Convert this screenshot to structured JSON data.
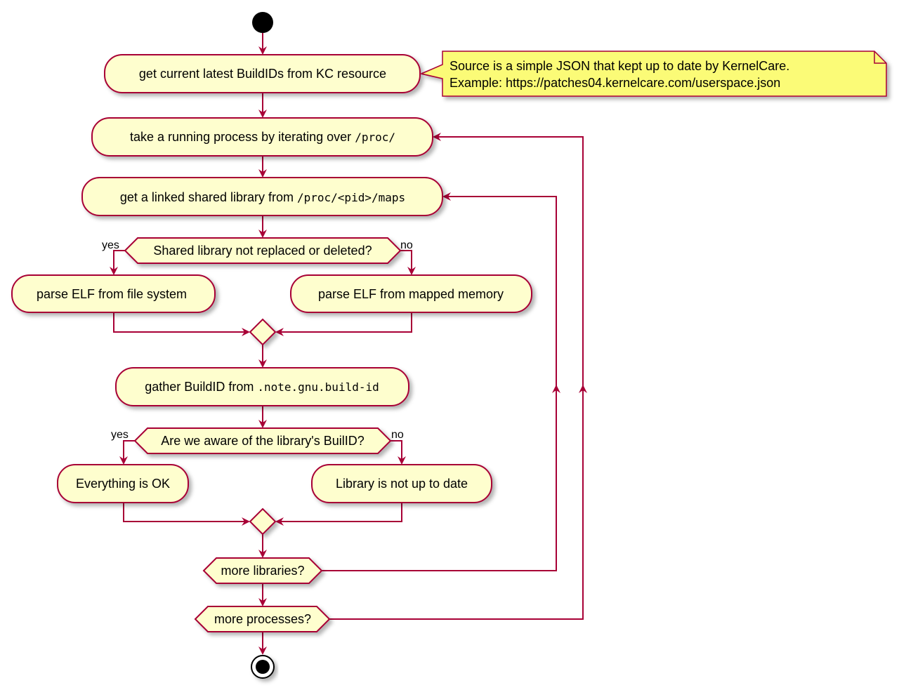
{
  "colors": {
    "fill": "#FEFECE",
    "stroke": "#A80036",
    "note_fill": "#FBFB77"
  },
  "nodes": {
    "get_buildids": "get current latest BuildIDs from KC resource",
    "take_process": {
      "text": "take a running process by iterating over ",
      "code": "/proc/"
    },
    "get_library": {
      "text": "get a linked shared library from ",
      "code": "/proc/<pid>/maps"
    },
    "decision_replaced": "Shared library not replaced or deleted?",
    "parse_fs": "parse ELF from file system",
    "parse_mem": "parse ELF from mapped memory",
    "gather_buildid": {
      "text": "gather BuildID from ",
      "code": ".note.gnu.build-id"
    },
    "decision_aware": "Are we aware of the library's BuilID?",
    "ok": "Everything is OK",
    "not_up_to_date": "Library is not up to date",
    "more_libraries": "more libraries?",
    "more_processes": "more processes?"
  },
  "labels": {
    "yes": "yes",
    "no": "no"
  },
  "note": {
    "line1": "Source is a simple JSON that kept up to date by KernelCare.",
    "line2": "Example: https://patches04.kernelcare.com/userspace.json"
  }
}
